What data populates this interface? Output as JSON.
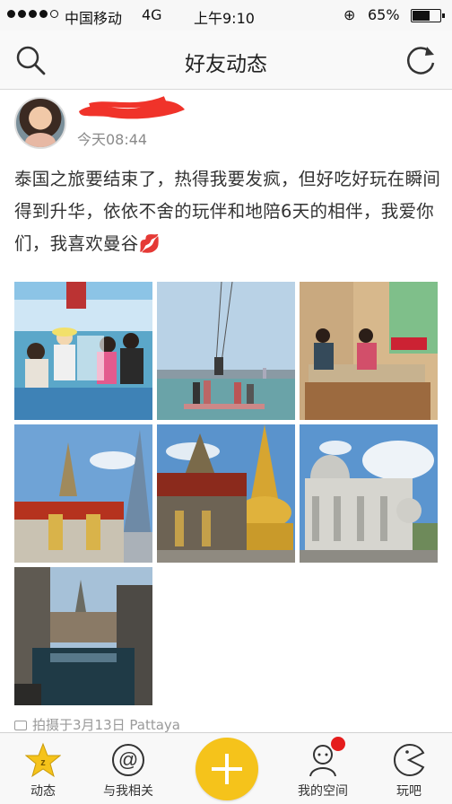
{
  "status_bar": {
    "carrier": "中国移动",
    "network": "4G",
    "time": "上午9:10",
    "battery": "65%",
    "battery_level": 0.65
  },
  "nav": {
    "title": "好友动态"
  },
  "post": {
    "time": "今天08:44",
    "text": "泰国之旅要结束了，热得我要发疯，但好吃好玩在瞬间得到升华，依依不舍的玩伴和地陪6天的相伴，我爱你们，我喜欢曼谷",
    "location": "拍摄于3月13日 Pattaya"
  },
  "tabs": [
    {
      "label": "动态"
    },
    {
      "label": "与我相关"
    },
    {
      "label": "我的空间"
    },
    {
      "label": "玩吧"
    }
  ],
  "colors": {
    "accent": "#f5c31b",
    "badge": "#e51d1d",
    "redaction": "#f0332a"
  }
}
